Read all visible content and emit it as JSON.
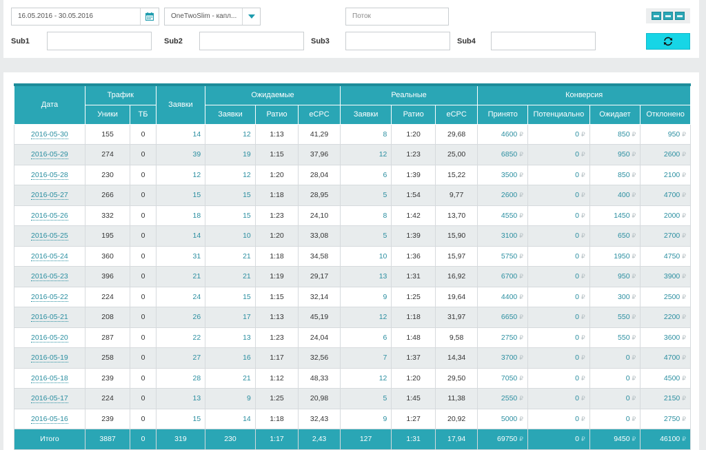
{
  "filters": {
    "date_range": "16.05.2016 - 30.05.2016",
    "offer": "OneTwoSlim - капл...",
    "stream_placeholder": "Поток",
    "sub1_label": "Sub1",
    "sub2_label": "Sub2",
    "sub3_label": "Sub3",
    "sub4_label": "Sub4",
    "sub1_value": "",
    "sub2_value": "",
    "sub3_value": "",
    "sub4_value": ""
  },
  "icons": {
    "calendar": "calendar-icon",
    "dropdown": "chevron-down-icon",
    "export": [
      "export-icon",
      "export-icon",
      "export-icon"
    ],
    "refresh": "refresh-icon"
  },
  "colors": {
    "accent": "#2aa6b5",
    "accent_dark": "#1d8c9a",
    "button": "#17d5e6",
    "link": "#2a8ea0"
  },
  "table": {
    "headers": {
      "date": "Дата",
      "traffic": "Трафик",
      "uniques": "Уники",
      "tb": "ТБ",
      "leads": "Заявки",
      "expected": "Ожидаемые",
      "exp_leads": "Заявки",
      "exp_ratio": "Ратио",
      "exp_ecpc": "eCPC",
      "real": "Реальные",
      "real_leads": "Заявки",
      "real_ratio": "Ратио",
      "real_ecpc": "eCPC",
      "conversion": "Конверсия",
      "accepted": "Принято",
      "potential": "Потенциально",
      "waiting": "Ожидает",
      "rejected": "Отклонено"
    },
    "currency": "₽",
    "rows": [
      {
        "date": "2016-05-30",
        "uniques": "155",
        "tb": "0",
        "leads": "14",
        "exp_leads": "12",
        "exp_ratio": "1:13",
        "exp_ecpc": "41,29",
        "real_leads": "8",
        "real_ratio": "1:20",
        "real_ecpc": "29,68",
        "accepted": "4600",
        "potential": "0",
        "waiting": "850",
        "rejected": "950"
      },
      {
        "date": "2016-05-29",
        "uniques": "274",
        "tb": "0",
        "leads": "39",
        "exp_leads": "19",
        "exp_ratio": "1:15",
        "exp_ecpc": "37,96",
        "real_leads": "12",
        "real_ratio": "1:23",
        "real_ecpc": "25,00",
        "accepted": "6850",
        "potential": "0",
        "waiting": "950",
        "rejected": "2600"
      },
      {
        "date": "2016-05-28",
        "uniques": "230",
        "tb": "0",
        "leads": "12",
        "exp_leads": "12",
        "exp_ratio": "1:20",
        "exp_ecpc": "28,04",
        "real_leads": "6",
        "real_ratio": "1:39",
        "real_ecpc": "15,22",
        "accepted": "3500",
        "potential": "0",
        "waiting": "850",
        "rejected": "2100"
      },
      {
        "date": "2016-05-27",
        "uniques": "266",
        "tb": "0",
        "leads": "15",
        "exp_leads": "15",
        "exp_ratio": "1:18",
        "exp_ecpc": "28,95",
        "real_leads": "5",
        "real_ratio": "1:54",
        "real_ecpc": "9,77",
        "accepted": "2600",
        "potential": "0",
        "waiting": "400",
        "rejected": "4700"
      },
      {
        "date": "2016-05-26",
        "uniques": "332",
        "tb": "0",
        "leads": "18",
        "exp_leads": "15",
        "exp_ratio": "1:23",
        "exp_ecpc": "24,10",
        "real_leads": "8",
        "real_ratio": "1:42",
        "real_ecpc": "13,70",
        "accepted": "4550",
        "potential": "0",
        "waiting": "1450",
        "rejected": "2000"
      },
      {
        "date": "2016-05-25",
        "uniques": "195",
        "tb": "0",
        "leads": "14",
        "exp_leads": "10",
        "exp_ratio": "1:20",
        "exp_ecpc": "33,08",
        "real_leads": "5",
        "real_ratio": "1:39",
        "real_ecpc": "15,90",
        "accepted": "3100",
        "potential": "0",
        "waiting": "650",
        "rejected": "2700"
      },
      {
        "date": "2016-05-24",
        "uniques": "360",
        "tb": "0",
        "leads": "31",
        "exp_leads": "21",
        "exp_ratio": "1:18",
        "exp_ecpc": "34,58",
        "real_leads": "10",
        "real_ratio": "1:36",
        "real_ecpc": "15,97",
        "accepted": "5750",
        "potential": "0",
        "waiting": "1950",
        "rejected": "4750"
      },
      {
        "date": "2016-05-23",
        "uniques": "396",
        "tb": "0",
        "leads": "21",
        "exp_leads": "21",
        "exp_ratio": "1:19",
        "exp_ecpc": "29,17",
        "real_leads": "13",
        "real_ratio": "1:31",
        "real_ecpc": "16,92",
        "accepted": "6700",
        "potential": "0",
        "waiting": "950",
        "rejected": "3900"
      },
      {
        "date": "2016-05-22",
        "uniques": "224",
        "tb": "0",
        "leads": "24",
        "exp_leads": "15",
        "exp_ratio": "1:15",
        "exp_ecpc": "32,14",
        "real_leads": "9",
        "real_ratio": "1:25",
        "real_ecpc": "19,64",
        "accepted": "4400",
        "potential": "0",
        "waiting": "300",
        "rejected": "2500"
      },
      {
        "date": "2016-05-21",
        "uniques": "208",
        "tb": "0",
        "leads": "26",
        "exp_leads": "17",
        "exp_ratio": "1:13",
        "exp_ecpc": "45,19",
        "real_leads": "12",
        "real_ratio": "1:18",
        "real_ecpc": "31,97",
        "accepted": "6650",
        "potential": "0",
        "waiting": "550",
        "rejected": "2200"
      },
      {
        "date": "2016-05-20",
        "uniques": "287",
        "tb": "0",
        "leads": "22",
        "exp_leads": "13",
        "exp_ratio": "1:23",
        "exp_ecpc": "24,04",
        "real_leads": "6",
        "real_ratio": "1:48",
        "real_ecpc": "9,58",
        "accepted": "2750",
        "potential": "0",
        "waiting": "550",
        "rejected": "3600"
      },
      {
        "date": "2016-05-19",
        "uniques": "258",
        "tb": "0",
        "leads": "27",
        "exp_leads": "16",
        "exp_ratio": "1:17",
        "exp_ecpc": "32,56",
        "real_leads": "7",
        "real_ratio": "1:37",
        "real_ecpc": "14,34",
        "accepted": "3700",
        "potential": "0",
        "waiting": "0",
        "rejected": "4700"
      },
      {
        "date": "2016-05-18",
        "uniques": "239",
        "tb": "0",
        "leads": "28",
        "exp_leads": "21",
        "exp_ratio": "1:12",
        "exp_ecpc": "48,33",
        "real_leads": "12",
        "real_ratio": "1:20",
        "real_ecpc": "29,50",
        "accepted": "7050",
        "potential": "0",
        "waiting": "0",
        "rejected": "4500"
      },
      {
        "date": "2016-05-17",
        "uniques": "224",
        "tb": "0",
        "leads": "13",
        "exp_leads": "9",
        "exp_ratio": "1:25",
        "exp_ecpc": "20,98",
        "real_leads": "5",
        "real_ratio": "1:45",
        "real_ecpc": "11,38",
        "accepted": "2550",
        "potential": "0",
        "waiting": "0",
        "rejected": "2150"
      },
      {
        "date": "2016-05-16",
        "uniques": "239",
        "tb": "0",
        "leads": "15",
        "exp_leads": "14",
        "exp_ratio": "1:18",
        "exp_ecpc": "32,43",
        "real_leads": "9",
        "real_ratio": "1:27",
        "real_ecpc": "20,92",
        "accepted": "5000",
        "potential": "0",
        "waiting": "0",
        "rejected": "2750"
      }
    ],
    "totals": {
      "label": "Итого",
      "uniques": "3887",
      "tb": "0",
      "leads": "319",
      "exp_leads": "230",
      "exp_ratio": "1:17",
      "exp_ecpc": "2,43",
      "real_leads": "127",
      "real_ratio": "1:31",
      "real_ecpc": "17,94",
      "accepted": "69750",
      "potential": "0",
      "waiting": "9450",
      "rejected": "46100"
    }
  }
}
